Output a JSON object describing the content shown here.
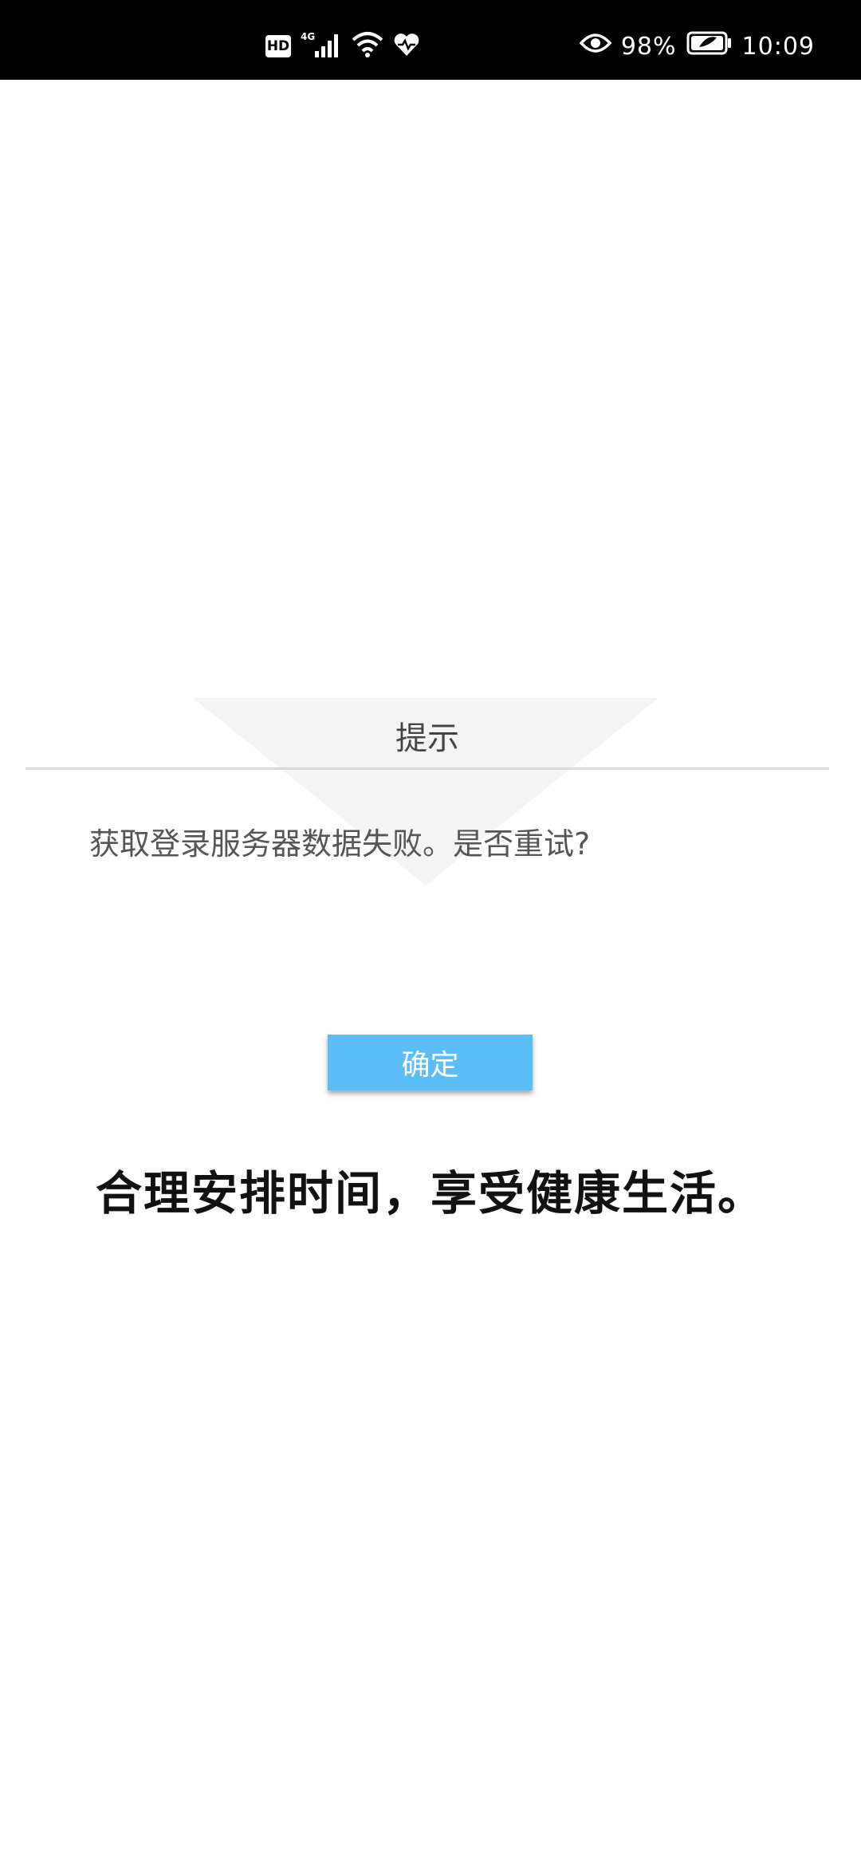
{
  "status_bar": {
    "hd_label": "HD",
    "network_label": "4G",
    "battery_percent": "98%",
    "time": "10:09",
    "icons": [
      "hd-badge",
      "signal-icon",
      "wifi-icon",
      "heart-icon",
      "eye-icon",
      "battery-icon"
    ]
  },
  "dialog": {
    "title": "提示",
    "message": "获取登录服务器数据失败。是否重试?",
    "confirm_label": "确定"
  },
  "splash": {
    "slogan": "合理安排时间，享受健康生活。"
  },
  "colors": {
    "status_bar_bg": "#000000",
    "button_bg": "#5bbdf8",
    "divider": "#d8d8d8"
  }
}
